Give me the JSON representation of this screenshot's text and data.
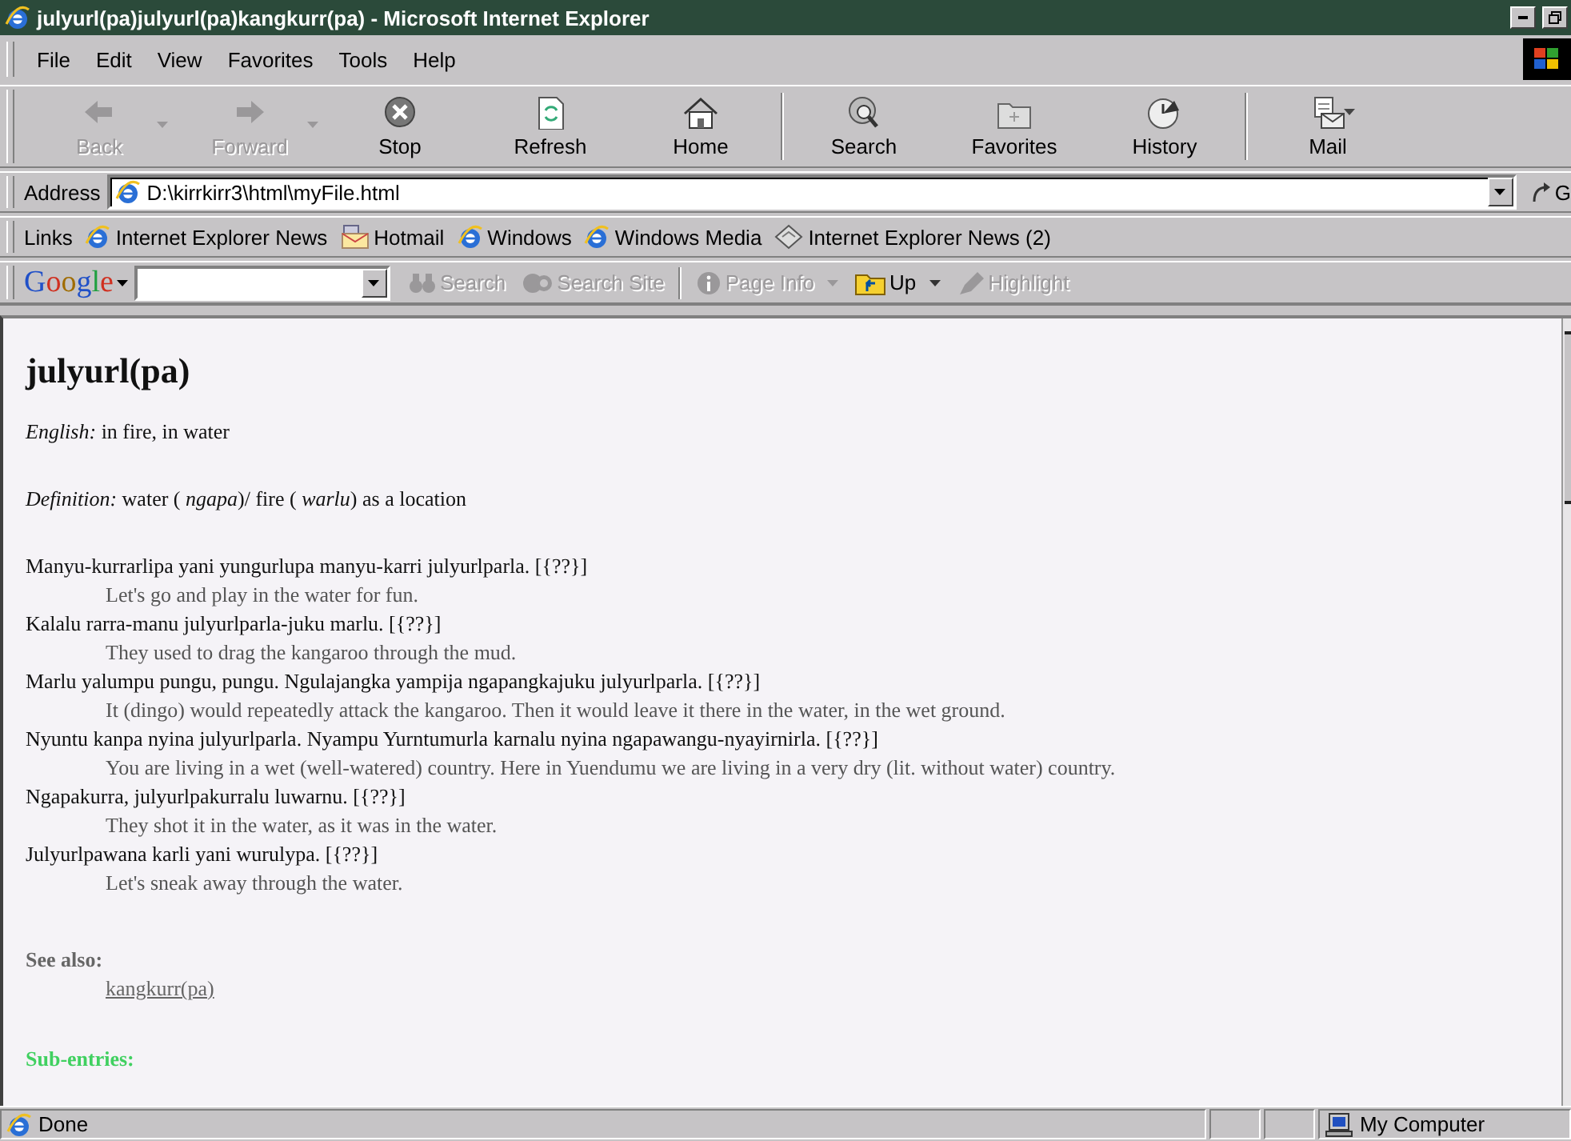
{
  "window": {
    "title": "julyurl(pa)julyurl(pa)kangkurr(pa) - Microsoft Internet Explorer"
  },
  "menu": [
    "File",
    "Edit",
    "View",
    "Favorites",
    "Tools",
    "Help"
  ],
  "toolbar": [
    [
      {
        "label": "Back",
        "kind": "back",
        "disabled": true,
        "dropdown": true
      },
      {
        "label": "Forward",
        "kind": "forward",
        "disabled": true,
        "dropdown": true
      },
      {
        "label": "Stop",
        "kind": "stop",
        "disabled": false,
        "dropdown": false
      },
      {
        "label": "Refresh",
        "kind": "refresh",
        "disabled": false,
        "dropdown": false
      },
      {
        "label": "Home",
        "kind": "home",
        "disabled": false,
        "dropdown": false
      }
    ],
    [
      {
        "label": "Search",
        "kind": "search",
        "disabled": false,
        "dropdown": false
      },
      {
        "label": "Favorites",
        "kind": "favorites",
        "disabled": false,
        "dropdown": false
      },
      {
        "label": "History",
        "kind": "history",
        "disabled": false,
        "dropdown": false
      }
    ],
    [
      {
        "label": "Mail",
        "kind": "mail",
        "disabled": false,
        "dropdown": true
      }
    ]
  ],
  "address": {
    "label": "Address",
    "value": "D:\\kirrkirr3\\html\\myFile.html",
    "go": "G"
  },
  "links": {
    "label": "Links",
    "items": [
      {
        "label": "Internet Explorer News",
        "kind": "page"
      },
      {
        "label": "Hotmail",
        "kind": "mail"
      },
      {
        "label": "Windows",
        "kind": "page"
      },
      {
        "label": "Windows Media",
        "kind": "page"
      },
      {
        "label": "Internet Explorer News (2)",
        "kind": "channel"
      }
    ]
  },
  "google_bar": {
    "logo": "Google",
    "items": [
      {
        "label": "Search",
        "kind": "search",
        "disabled": true,
        "dropdown": false
      },
      {
        "label": "Search Site",
        "kind": "site",
        "disabled": true,
        "dropdown": false
      },
      {
        "label": "Page Info",
        "kind": "info",
        "disabled": true,
        "dropdown": true
      },
      {
        "label": "Up",
        "kind": "up",
        "disabled": false,
        "dropdown": true
      },
      {
        "label": "Highlight",
        "kind": "highlight",
        "disabled": true,
        "dropdown": false
      }
    ]
  },
  "entry": {
    "headword": "julyurl(pa)",
    "english": "*English:* in fire, in water",
    "definition": "*Definition:* water ( *ngapa*)/ fire ( *warlu*) as a location",
    "examples": [
      {
        "text": "Manyu-kurrarlipa yani yungurlupa manyu-karri julyurlparla. [{??}]",
        "translation": "Let's go and play in the water for fun."
      },
      {
        "text": "Kalalu rarra-manu julyurlparla-juku marlu. [{??}]",
        "translation": "They used to drag the kangaroo through the mud."
      },
      {
        "text": "Marlu yalumpu pungu, pungu. Ngulajangka yampija ngapangkajuku julyurlparla. [{??}]",
        "translation": "It (dingo) would repeatedly attack the kangaroo. Then it would leave it there in the water, in the wet ground."
      },
      {
        "text": "Nyuntu kanpa nyina julyurlparla. Nyampu Yurntumurla karnalu nyina ngapawangu-nyayirnirla. [{??}]",
        "translation": "You are living in a wet (well-watered) country. Here in Yuendumu we are living in a very dry (lit. without water) country."
      },
      {
        "text": "Ngapakurra, julyurlpakurralu luwarnu. [{??}]",
        "translation": "They shot it in the water, as it was in the water."
      },
      {
        "text": "Julyurlpawana karli yani wurulypa. [{??}]",
        "translation": "Let's sneak away through the water."
      }
    ],
    "see_also": {
      "heading": "See also:",
      "links": [
        "kangkurr(pa)"
      ]
    },
    "sub_entries": {
      "heading": "Sub-entries:"
    }
  },
  "status_bar": {
    "text": "Done",
    "zone": "My Computer"
  }
}
